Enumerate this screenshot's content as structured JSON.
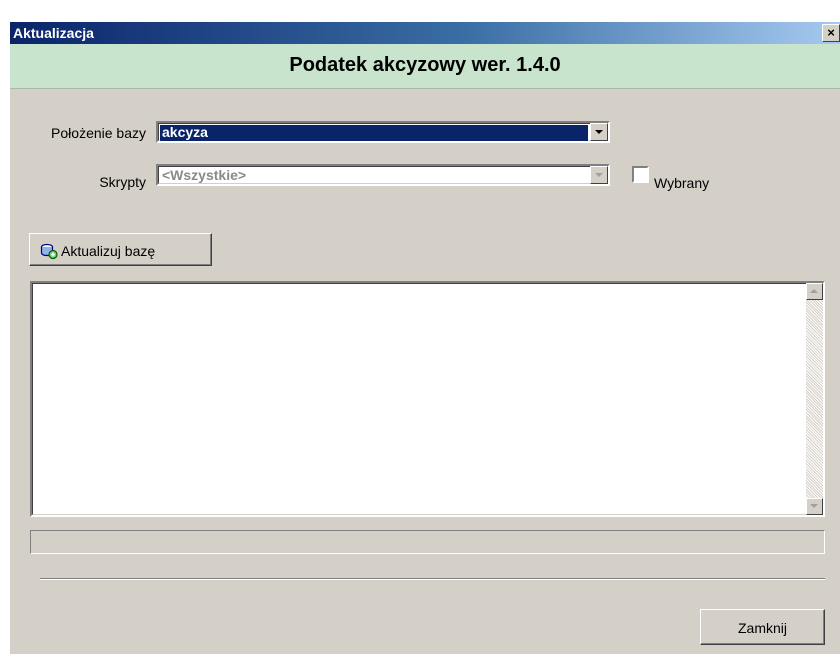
{
  "window": {
    "title": "Aktualizacja",
    "close_symbol": "×"
  },
  "header": {
    "title": "Podatek akcyzowy wer. 1.4.0"
  },
  "form": {
    "db_location_label": "Położenie bazy",
    "db_location_value": "akcyza",
    "scripts_label": "Skrypty",
    "scripts_value": "<Wszystkie>",
    "selected_checkbox_label": "Wybrany",
    "selected_checked": false
  },
  "actions": {
    "update_button_label": "Aktualizuj bazę",
    "update_button_icon": "database-update-icon",
    "close_button_label": "Zamknij"
  },
  "log": {
    "text": ""
  },
  "progress": {
    "fraction": 0
  },
  "colors": {
    "title_gradient_start": "#0a246a",
    "header_band": "#c8e4cc",
    "selection": "#0a246a",
    "dialog_face": "#d4d0c8"
  }
}
